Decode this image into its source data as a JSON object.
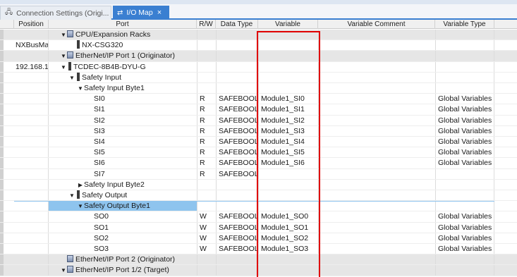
{
  "tabs": [
    {
      "label": "Connection Settings (Origi...",
      "icon": "network-icon",
      "active": false
    },
    {
      "label": "I/O Map",
      "icon": "io-map-icon",
      "active": true,
      "close": "×"
    }
  ],
  "columns": {
    "position": "Position",
    "port": "Port",
    "rw": "R/W",
    "data_type": "Data Type",
    "variable": "Variable",
    "variable_comment": "Variable Comment",
    "variable_type": "Variable Type"
  },
  "rows": [
    {
      "kind": "group",
      "indent": 1,
      "twisty": "▼",
      "icon": "rack",
      "port": "CPU/Expansion Racks",
      "position": "",
      "rw": "",
      "data_type": "",
      "variable": "",
      "variable_type": ""
    },
    {
      "kind": "item",
      "indent": 2,
      "twisty": "",
      "icon": "unit",
      "port": "NX-CSG320",
      "position": "NXBusMa:",
      "rw": "",
      "data_type": "",
      "variable": "",
      "variable_type": ""
    },
    {
      "kind": "group",
      "indent": 1,
      "twisty": "▼",
      "icon": "rack",
      "port": "EtherNet/IP Port 1 (Originator)",
      "position": "",
      "rw": "",
      "data_type": "",
      "variable": "",
      "variable_type": ""
    },
    {
      "kind": "item",
      "indent": 1,
      "twisty": "▼",
      "icon": "unit",
      "port": "TCDEC-8B4B-DYU-G",
      "position": "192.168.1:",
      "rw": "",
      "data_type": "",
      "variable": "",
      "variable_type": ""
    },
    {
      "kind": "item",
      "indent": 2,
      "twisty": "▼",
      "icon": "unit",
      "port": "Safety Input",
      "position": "",
      "rw": "",
      "data_type": "",
      "variable": "",
      "variable_type": ""
    },
    {
      "kind": "item",
      "indent": 3,
      "twisty": "▼",
      "icon": "",
      "port": "Safety Input Byte1",
      "position": "",
      "rw": "",
      "data_type": "",
      "variable": "",
      "variable_type": ""
    },
    {
      "kind": "item",
      "indent": 5,
      "twisty": "",
      "icon": "",
      "port": "SI0",
      "position": "",
      "rw": "R",
      "data_type": "SAFEBOOL",
      "variable": "Module1_SI0",
      "variable_type": "Global Variables"
    },
    {
      "kind": "item",
      "indent": 5,
      "twisty": "",
      "icon": "",
      "port": "SI1",
      "position": "",
      "rw": "R",
      "data_type": "SAFEBOOL",
      "variable": "Module1_SI1",
      "variable_type": "Global Variables"
    },
    {
      "kind": "item",
      "indent": 5,
      "twisty": "",
      "icon": "",
      "port": "SI2",
      "position": "",
      "rw": "R",
      "data_type": "SAFEBOOL",
      "variable": "Module1_SI2",
      "variable_type": "Global Variables"
    },
    {
      "kind": "item",
      "indent": 5,
      "twisty": "",
      "icon": "",
      "port": "SI3",
      "position": "",
      "rw": "R",
      "data_type": "SAFEBOOL",
      "variable": "Module1_SI3",
      "variable_type": "Global Variables"
    },
    {
      "kind": "item",
      "indent": 5,
      "twisty": "",
      "icon": "",
      "port": "SI4",
      "position": "",
      "rw": "R",
      "data_type": "SAFEBOOL",
      "variable": "Module1_SI4",
      "variable_type": "Global Variables"
    },
    {
      "kind": "item",
      "indent": 5,
      "twisty": "",
      "icon": "",
      "port": "SI5",
      "position": "",
      "rw": "R",
      "data_type": "SAFEBOOL",
      "variable": "Module1_SI5",
      "variable_type": "Global Variables"
    },
    {
      "kind": "item",
      "indent": 5,
      "twisty": "",
      "icon": "",
      "port": "SI6",
      "position": "",
      "rw": "R",
      "data_type": "SAFEBOOL",
      "variable": "Module1_SI6",
      "variable_type": "Global Variables"
    },
    {
      "kind": "item",
      "indent": 5,
      "twisty": "",
      "icon": "",
      "port": "SI7",
      "position": "",
      "rw": "R",
      "data_type": "SAFEBOOL",
      "variable": "",
      "variable_type": ""
    },
    {
      "kind": "item",
      "indent": 3,
      "twisty": "▶",
      "icon": "",
      "port": "Safety Input Byte2",
      "position": "",
      "rw": "",
      "data_type": "",
      "variable": "",
      "variable_type": ""
    },
    {
      "kind": "item",
      "indent": 2,
      "twisty": "▼",
      "icon": "unit",
      "port": "Safety Output",
      "position": "",
      "rw": "",
      "data_type": "",
      "variable": "",
      "variable_type": ""
    },
    {
      "kind": "selected",
      "indent": 3,
      "twisty": "▼",
      "icon": "",
      "port": "Safety Output Byte1",
      "position": "",
      "rw": "",
      "data_type": "",
      "variable": "",
      "variable_type": ""
    },
    {
      "kind": "item",
      "indent": 5,
      "twisty": "",
      "icon": "",
      "port": "SO0",
      "position": "",
      "rw": "W",
      "data_type": "SAFEBOOL",
      "variable": "Module1_SO0",
      "variable_type": "Global Variables"
    },
    {
      "kind": "item",
      "indent": 5,
      "twisty": "",
      "icon": "",
      "port": "SO1",
      "position": "",
      "rw": "W",
      "data_type": "SAFEBOOL",
      "variable": "Module1_SO1",
      "variable_type": "Global Variables"
    },
    {
      "kind": "item",
      "indent": 5,
      "twisty": "",
      "icon": "",
      "port": "SO2",
      "position": "",
      "rw": "W",
      "data_type": "SAFEBOOL",
      "variable": "Module1_SO2",
      "variable_type": "Global Variables"
    },
    {
      "kind": "item",
      "indent": 5,
      "twisty": "",
      "icon": "",
      "port": "SO3",
      "position": "",
      "rw": "W",
      "data_type": "SAFEBOOL",
      "variable": "Module1_SO3",
      "variable_type": "Global Variables"
    },
    {
      "kind": "group",
      "indent": 1,
      "twisty": "",
      "icon": "rack",
      "port": "EtherNet/IP Port 2 (Originator)",
      "position": "",
      "rw": "",
      "data_type": "",
      "variable": "",
      "variable_type": ""
    },
    {
      "kind": "group",
      "indent": 1,
      "twisty": "▼",
      "icon": "rack",
      "port": "EtherNet/IP Port 1/2 (Target)",
      "position": "",
      "rw": "",
      "data_type": "",
      "variable": "",
      "variable_type": ""
    }
  ],
  "colors": {
    "active_tab": "#3a7fd1",
    "selection": "#8ec4ee",
    "highlight_box": "#e00000",
    "group_row": "#e6e6e6"
  }
}
